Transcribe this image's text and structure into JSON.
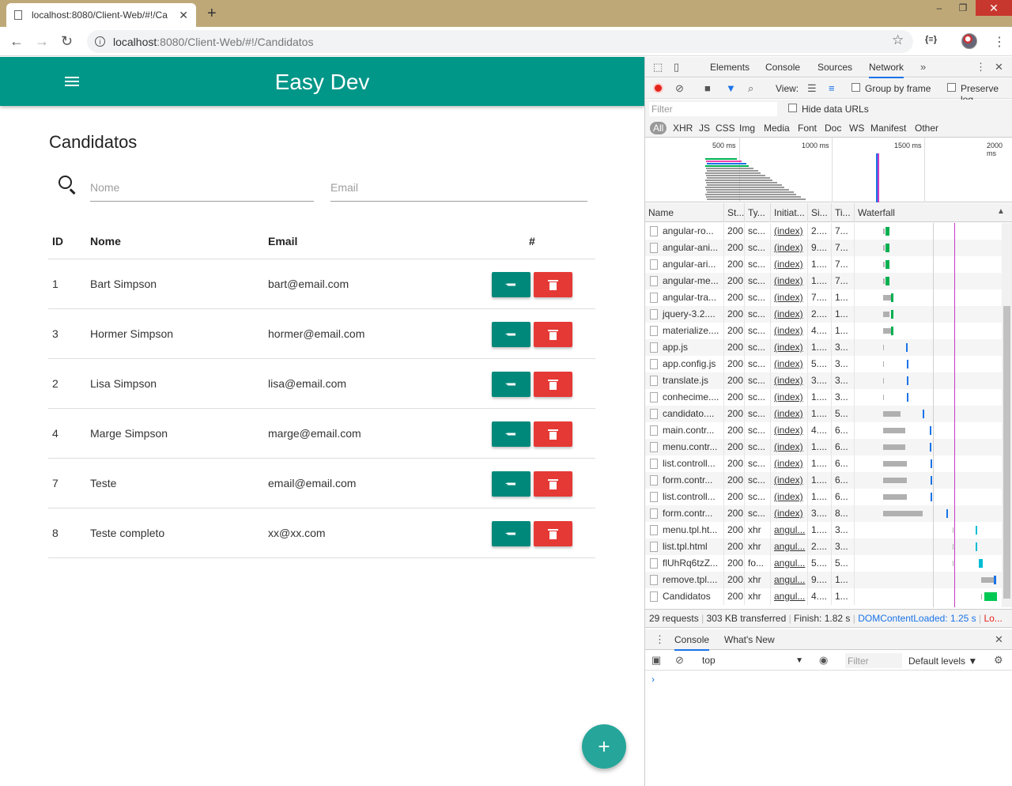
{
  "browser": {
    "tab_title": "localhost:8080/Client-Web/#!/Ca",
    "url_host": "localhost",
    "url_rest": ":8080/Client-Web/#!/Candidatos",
    "window_controls": [
      "–",
      "❐",
      "✕"
    ]
  },
  "app": {
    "brand": "Easy Dev",
    "page_title": "Candidatos",
    "search": {
      "nome_placeholder": "Nome",
      "email_placeholder": "Email"
    },
    "table": {
      "headers": {
        "id": "ID",
        "nome": "Nome",
        "email": "Email",
        "actions": "#"
      },
      "rows": [
        {
          "id": "1",
          "nome": "Bart Simpson",
          "email": "bart@email.com"
        },
        {
          "id": "3",
          "nome": "Hormer Simpson",
          "email": "hormer@email.com"
        },
        {
          "id": "2",
          "nome": "Lisa Simpson",
          "email": "lisa@email.com"
        },
        {
          "id": "4",
          "nome": "Marge Simpson",
          "email": "marge@email.com"
        },
        {
          "id": "7",
          "nome": "Teste",
          "email": "email@email.com"
        },
        {
          "id": "8",
          "nome": "Teste completo",
          "email": "xx@xx.com"
        }
      ]
    },
    "fab_label": "+",
    "colors": {
      "primary": "#009688",
      "edit": "#00897b",
      "delete": "#e53935",
      "fab": "#26a69a"
    }
  },
  "devtools": {
    "tabs": [
      "Elements",
      "Console",
      "Sources",
      "Network"
    ],
    "active_tab": "Network",
    "toolbar": {
      "view_label": "View:",
      "group_by_frame": "Group by frame",
      "preserve_log": "Preserve log"
    },
    "filter_placeholder": "Filter",
    "hide_data_urls": "Hide data URLs",
    "types": [
      "All",
      "XHR",
      "JS",
      "CSS",
      "Img",
      "Media",
      "Font",
      "Doc",
      "WS",
      "Manifest",
      "Other"
    ],
    "overview_ticks": [
      "500 ms",
      "1000 ms",
      "1500 ms",
      "2000 ms"
    ],
    "columns": [
      "Name",
      "St...",
      "Ty...",
      "Initiat...",
      "Si...",
      "Ti...",
      "Waterfall"
    ],
    "requests": [
      {
        "name": "angular-ro...",
        "status": "200",
        "type": "sc...",
        "initiator": "(index)",
        "size": "2....",
        "time": "7..."
      },
      {
        "name": "angular-ani...",
        "status": "200",
        "type": "sc...",
        "initiator": "(index)",
        "size": "9....",
        "time": "7..."
      },
      {
        "name": "angular-ari...",
        "status": "200",
        "type": "sc...",
        "initiator": "(index)",
        "size": "1....",
        "time": "7..."
      },
      {
        "name": "angular-me...",
        "status": "200",
        "type": "sc...",
        "initiator": "(index)",
        "size": "1....",
        "time": "7..."
      },
      {
        "name": "angular-tra...",
        "status": "200",
        "type": "sc...",
        "initiator": "(index)",
        "size": "7....",
        "time": "1..."
      },
      {
        "name": "jquery-3.2....",
        "status": "200",
        "type": "sc...",
        "initiator": "(index)",
        "size": "2....",
        "time": "1..."
      },
      {
        "name": "materialize....",
        "status": "200",
        "type": "sc...",
        "initiator": "(index)",
        "size": "4....",
        "time": "1..."
      },
      {
        "name": "app.js",
        "status": "200",
        "type": "sc...",
        "initiator": "(index)",
        "size": "1....",
        "time": "3..."
      },
      {
        "name": "app.config.js",
        "status": "200",
        "type": "sc...",
        "initiator": "(index)",
        "size": "5....",
        "time": "3..."
      },
      {
        "name": "translate.js",
        "status": "200",
        "type": "sc...",
        "initiator": "(index)",
        "size": "3....",
        "time": "3..."
      },
      {
        "name": "conhecime....",
        "status": "200",
        "type": "sc...",
        "initiator": "(index)",
        "size": "1....",
        "time": "3..."
      },
      {
        "name": "candidato....",
        "status": "200",
        "type": "sc...",
        "initiator": "(index)",
        "size": "1....",
        "time": "5..."
      },
      {
        "name": "main.contr...",
        "status": "200",
        "type": "sc...",
        "initiator": "(index)",
        "size": "4....",
        "time": "6..."
      },
      {
        "name": "menu.contr...",
        "status": "200",
        "type": "sc...",
        "initiator": "(index)",
        "size": "1....",
        "time": "6..."
      },
      {
        "name": "list.controll...",
        "status": "200",
        "type": "sc...",
        "initiator": "(index)",
        "size": "1....",
        "time": "6..."
      },
      {
        "name": "form.contr...",
        "status": "200",
        "type": "sc...",
        "initiator": "(index)",
        "size": "1....",
        "time": "6..."
      },
      {
        "name": "list.controll...",
        "status": "200",
        "type": "sc...",
        "initiator": "(index)",
        "size": "1....",
        "time": "6..."
      },
      {
        "name": "form.contr...",
        "status": "200",
        "type": "sc...",
        "initiator": "(index)",
        "size": "3....",
        "time": "8..."
      },
      {
        "name": "menu.tpl.ht...",
        "status": "200",
        "type": "xhr",
        "initiator": "angul...",
        "size": "1....",
        "time": "3..."
      },
      {
        "name": "list.tpl.html",
        "status": "200",
        "type": "xhr",
        "initiator": "angul...",
        "size": "2....",
        "time": "3..."
      },
      {
        "name": "flUhRq6tzZ...",
        "status": "200",
        "type": "fo...",
        "initiator": "angul...",
        "size": "5....",
        "time": "5..."
      },
      {
        "name": "remove.tpl....",
        "status": "200",
        "type": "xhr",
        "initiator": "angul...",
        "size": "9....",
        "time": "1..."
      },
      {
        "name": "Candidatos",
        "status": "200",
        "type": "xhr",
        "initiator": "angul...",
        "size": "4....",
        "time": "1..."
      }
    ],
    "summary": {
      "requests": "29 requests",
      "transferred": "303 KB transferred",
      "finish": "Finish: 1.82 s",
      "dom_content_loaded": "DOMContentLoaded: 1.25 s",
      "load": "Lo..."
    },
    "drawer": {
      "tabs": [
        "Console",
        "What's New"
      ],
      "context": "top",
      "filter_placeholder": "Filter",
      "levels": "Default levels ▼",
      "prompt": "›"
    }
  }
}
